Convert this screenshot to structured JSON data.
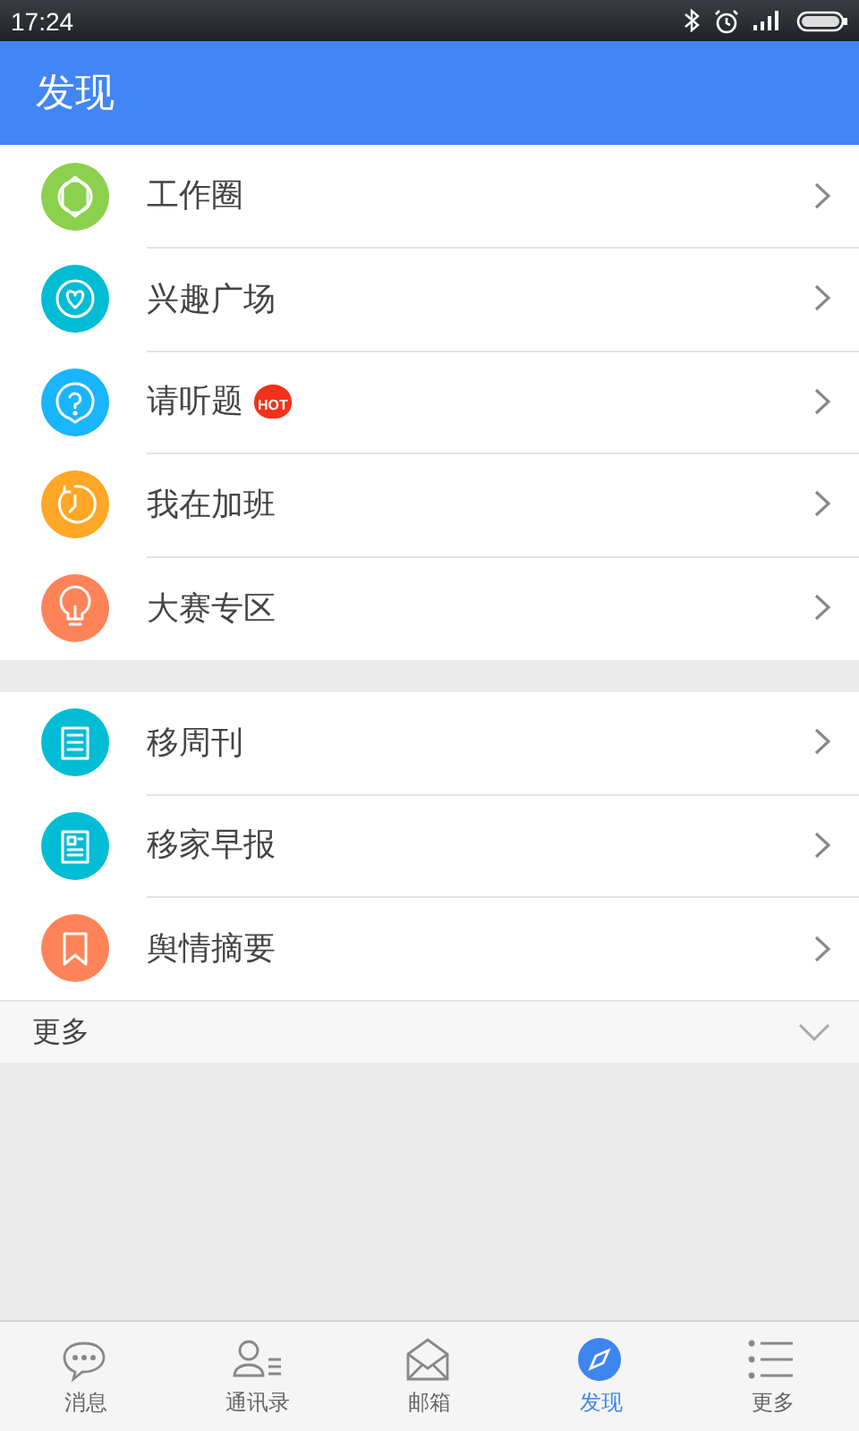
{
  "status_bar": {
    "time": "17:24"
  },
  "header": {
    "title": "发现"
  },
  "sections": [
    {
      "items": [
        {
          "label": "工作圈",
          "color": "#8bd14d"
        },
        {
          "label": "兴趣广场",
          "color": "#00bcd4"
        },
        {
          "label": "请听题",
          "color": "#19b5fe",
          "badge": "HOT"
        },
        {
          "label": "我在加班",
          "color": "#ffa726"
        },
        {
          "label": "大赛专区",
          "color": "#ff8358"
        }
      ]
    },
    {
      "items": [
        {
          "label": "移周刊",
          "color": "#00bcd4"
        },
        {
          "label": "移家早报",
          "color": "#00bcd4"
        },
        {
          "label": "舆情摘要",
          "color": "#ff8358"
        }
      ]
    }
  ],
  "more_row": {
    "label": "更多",
    "expanded": false
  },
  "tabs": [
    {
      "label": "消息",
      "selected": false
    },
    {
      "label": "通讯录",
      "selected": false
    },
    {
      "label": "邮箱",
      "selected": false
    },
    {
      "label": "发现",
      "selected": true
    },
    {
      "label": "更多",
      "selected": false
    }
  ]
}
